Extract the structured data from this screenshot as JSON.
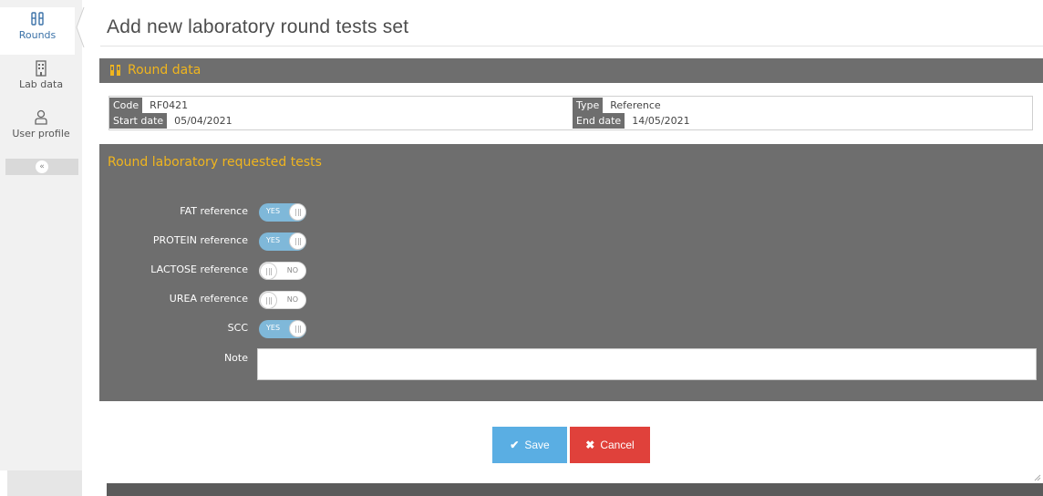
{
  "sidebar": {
    "items": [
      {
        "label": "Rounds",
        "icon": "flask-icon"
      },
      {
        "label": "Lab data",
        "icon": "building-icon"
      },
      {
        "label": "User profile",
        "icon": "user-icon"
      }
    ],
    "collapse_glyph": "«"
  },
  "page": {
    "title": "Add new laboratory round tests set"
  },
  "round_data": {
    "header": "Round data",
    "code_label": "Code",
    "code_value": "RF0421",
    "type_label": "Type",
    "type_value": "Reference",
    "start_label": "Start date",
    "start_value": "05/04/2021",
    "end_label": "End date",
    "end_value": "14/05/2021"
  },
  "tests": {
    "title": "Round laboratory requested tests",
    "items": [
      {
        "label": "FAT reference",
        "state": "YES",
        "on": true
      },
      {
        "label": "PROTEIN reference",
        "state": "YES",
        "on": true
      },
      {
        "label": "LACTOSE reference",
        "state": "NO",
        "on": false
      },
      {
        "label": "UREA reference",
        "state": "NO",
        "on": false
      },
      {
        "label": "SCC",
        "state": "YES",
        "on": true
      }
    ],
    "note_label": "Note",
    "note_value": ""
  },
  "actions": {
    "save_label": "Save",
    "cancel_label": "Cancel"
  },
  "colors": {
    "accent": "#f0b51e",
    "panel": "#6e6e6e",
    "save": "#5aaee3",
    "cancel": "#e0413b",
    "toggle_on": "#7fb8d9"
  }
}
